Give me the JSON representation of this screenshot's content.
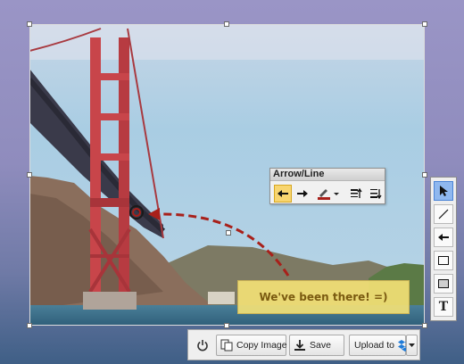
{
  "annotation_panel": {
    "title": "Arrow/Line",
    "buttons": [
      {
        "name": "arrow-left-style",
        "icon": "arrow-left-icon",
        "active": true
      },
      {
        "name": "arrow-right-style",
        "icon": "arrow-right-icon",
        "active": false
      },
      {
        "name": "line-color",
        "icon": "color-picker-icon",
        "active": false
      },
      {
        "name": "line-thickness-up",
        "icon": "thickness-up-icon",
        "active": false
      },
      {
        "name": "line-thickness-down",
        "icon": "thickness-down-icon",
        "active": false
      }
    ]
  },
  "tool_palette": {
    "tools": [
      {
        "name": "select",
        "icon": "cursor-icon",
        "active": true
      },
      {
        "name": "line",
        "icon": "line-icon",
        "active": false
      },
      {
        "name": "arrow",
        "icon": "arrow-icon",
        "active": false
      },
      {
        "name": "rectangle",
        "icon": "rectangle-icon",
        "active": false
      },
      {
        "name": "filled-rectangle",
        "icon": "filled-rectangle-icon",
        "active": false
      },
      {
        "name": "text",
        "icon": "text-icon",
        "active": false
      }
    ],
    "text_glyph": "T"
  },
  "note": {
    "text": "We've been there! =)"
  },
  "actions": {
    "power_icon": "power-icon",
    "copy_label": "Copy Image",
    "save_label": "Save",
    "upload_label": "Upload to",
    "upload_service_icon": "dropbox-icon"
  },
  "colors": {
    "accent_active": "#f8d56f",
    "tool_active": "#8fb8ef",
    "annotation_red": "#a8201a",
    "note_fill": "#f5e276"
  }
}
